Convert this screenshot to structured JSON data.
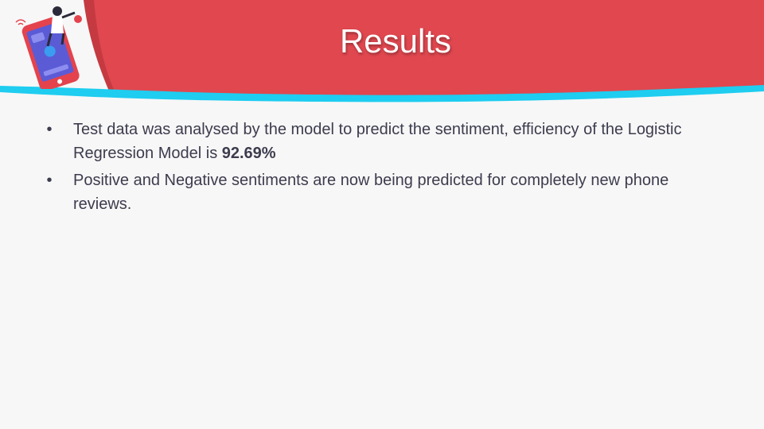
{
  "slide": {
    "title": "Results",
    "bullets": [
      {
        "marker": "•",
        "text": "Test data was analysed by the model to predict the sentiment, efficiency of the Logistic Regression Model is ",
        "emphasis": "92.69%"
      },
      {
        "marker": "•",
        "text": "Positive and Negative sentiments are now being predicted for completely new phone reviews.",
        "emphasis": ""
      }
    ]
  },
  "colors": {
    "header_red": "#e0474f",
    "dark_red": "#b93036",
    "wave_cyan": "#1ecdf0",
    "background": "#f7f7f7",
    "text": "#3c3c4e"
  },
  "icons": [
    "phone-illustration-icon",
    "woman-figure-icon",
    "wifi-icon",
    "heart-icon"
  ]
}
